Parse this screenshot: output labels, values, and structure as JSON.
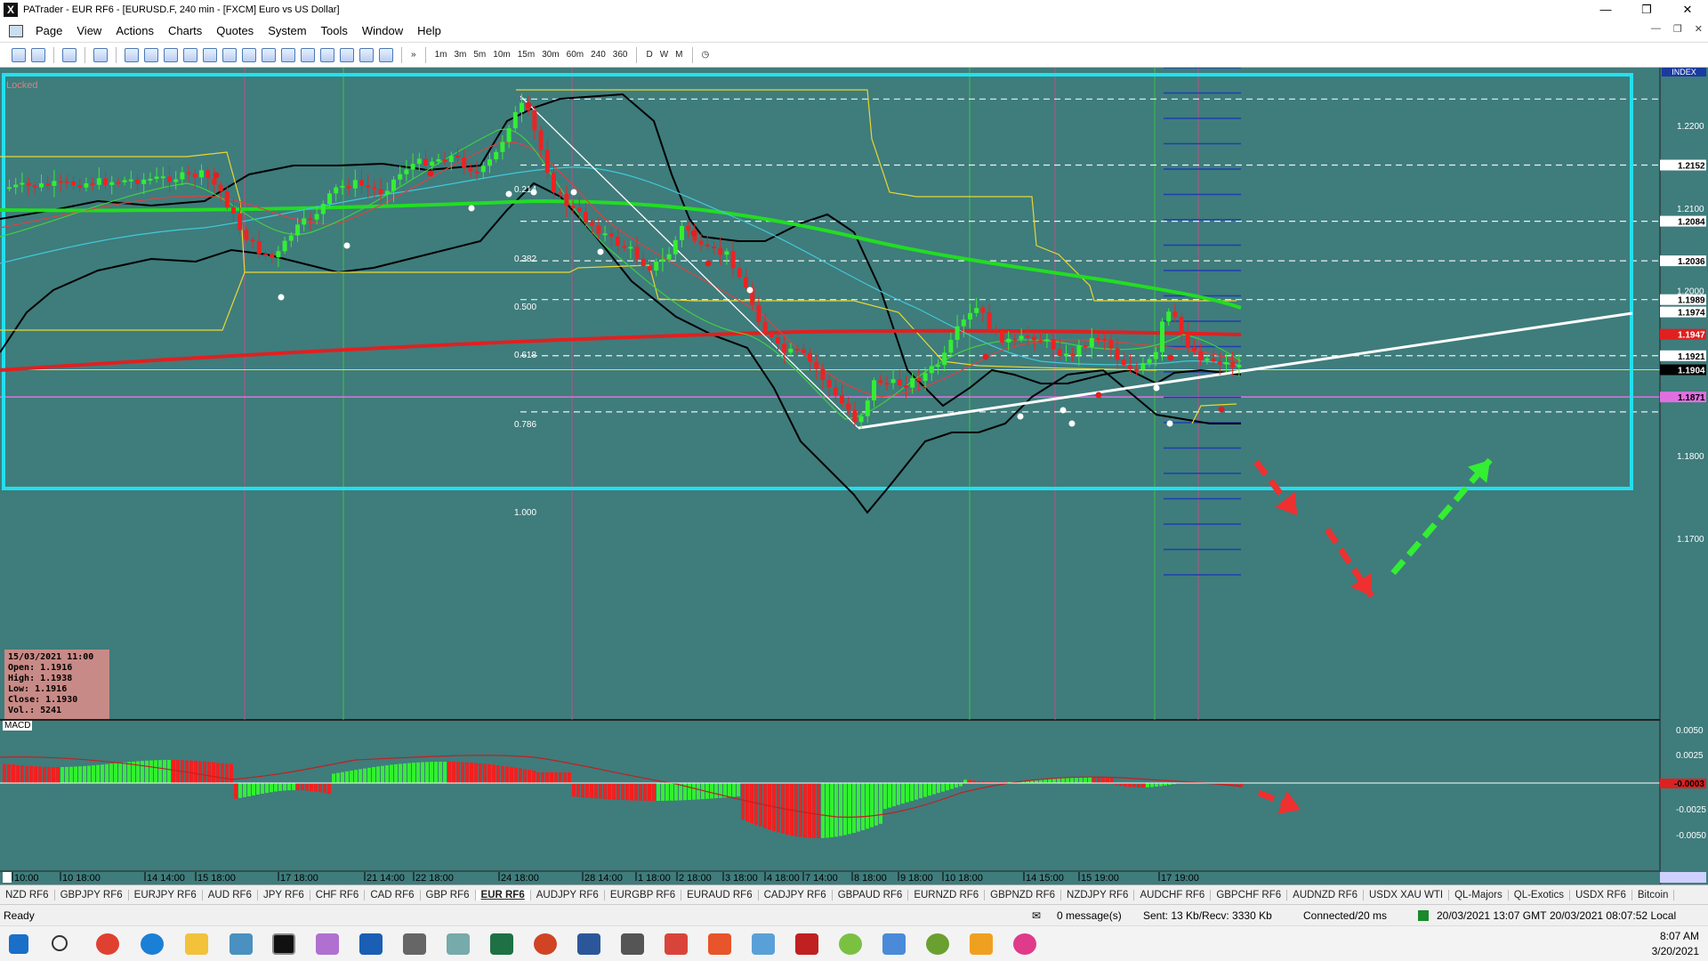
{
  "window": {
    "title": "PATrader - EUR RF6 - [EURUSD.F, 240 min - [FXCM] Euro vs US Dollar]",
    "app_icon_glyph": "X"
  },
  "menu": {
    "items": [
      "Page",
      "View",
      "Actions",
      "Charts",
      "Quotes",
      "System",
      "Tools",
      "Window",
      "Help"
    ]
  },
  "toolbar": {
    "timeframes": [
      "1m",
      "3m",
      "5m",
      "10m",
      "15m",
      "30m",
      "60m",
      "240",
      "360",
      "D",
      "W",
      "M"
    ]
  },
  "chart": {
    "locked_label": "Locked",
    "index_label": "INDEX",
    "macd_label": "MACD",
    "price_ticks": [
      "1.2200",
      "1.2100",
      "1.2000",
      "1.1800",
      "1.1700"
    ],
    "price_markers": [
      {
        "value": "1.2152",
        "color": "#ffffff"
      },
      {
        "value": "1.2084",
        "color": "#ffffff"
      },
      {
        "value": "1.2036",
        "color": "#ffffff"
      },
      {
        "value": "1.1989",
        "color": "#ffffff"
      },
      {
        "value": "1.1974",
        "color": "#ffffff"
      },
      {
        "value": "1.1947",
        "color": "#e02020"
      },
      {
        "value": "1.1921",
        "color": "#ffffff"
      },
      {
        "value": "1.1904",
        "color": "#000000"
      },
      {
        "value": "1.1871",
        "color": "#e070e0"
      }
    ],
    "macd_ticks": [
      "0.0050",
      "0.0025",
      "-0.0025",
      "-0.0050"
    ],
    "macd_marker": "-0.0003",
    "fib_levels": [
      "0.214",
      "0.382",
      "0.500",
      "0.618",
      "0.786",
      "1.000"
    ],
    "time_labels": [
      "10:00",
      "10 18:00",
      "14 14:00",
      "15 18:00",
      "17 18:00",
      "21 14:00",
      "22 18:00",
      "24 18:00",
      "28 14:00",
      "1 18:00",
      "2 18:00",
      "3 18:00",
      "4 18:00",
      "7 14:00",
      "8 18:00",
      "9 18:00",
      "10 18:00",
      "14 15:00",
      "15 19:00",
      "17 19:00"
    ],
    "info_box": {
      "date": "15/03/2021 11:00",
      "open": "Open: 1.1916",
      "high": "High: 1.1938",
      "low": "Low: 1.1916",
      "close": "Close: 1.1930",
      "vol": "Vol.: 5241"
    }
  },
  "symbol_tabs": [
    "NZD RF6",
    "GBPJPY RF6",
    "EURJPY RF6",
    "AUD RF6",
    "JPY RF6",
    "CHF RF6",
    "CAD RF6",
    "GBP RF6",
    "EUR RF6",
    "AUDJPY RF6",
    "EURGBP RF6",
    "EURAUD RF6",
    "CADJPY RF6",
    "GBPAUD RF6",
    "EURNZD RF6",
    "GBPNZD RF6",
    "NZDJPY RF6",
    "AUDCHF RF6",
    "GBPCHF RF6",
    "AUDNZD RF6",
    "USDX XAU WTI",
    "QL-Majors",
    "QL-Exotics",
    "USDX RF6",
    "Bitcoin"
  ],
  "active_tab": "EUR RF6",
  "status": {
    "ready": "Ready",
    "messages": "0 message(s)",
    "sent": "Sent: 13 Kb/Recv: 3330 Kb",
    "connected": "Connected/20 ms",
    "gmt_time": "20/03/2021 13:07 GMT",
    "local_time": "20/03/2021 08:07:52 Local"
  },
  "taskbar": {
    "time": "8:07 AM",
    "date": "3/20/2021"
  },
  "colors": {
    "chart_bg": "#3f7c7c",
    "bull_candle": "#33ee33",
    "bear_candle": "#ee2222",
    "box": "#22e0ee"
  }
}
